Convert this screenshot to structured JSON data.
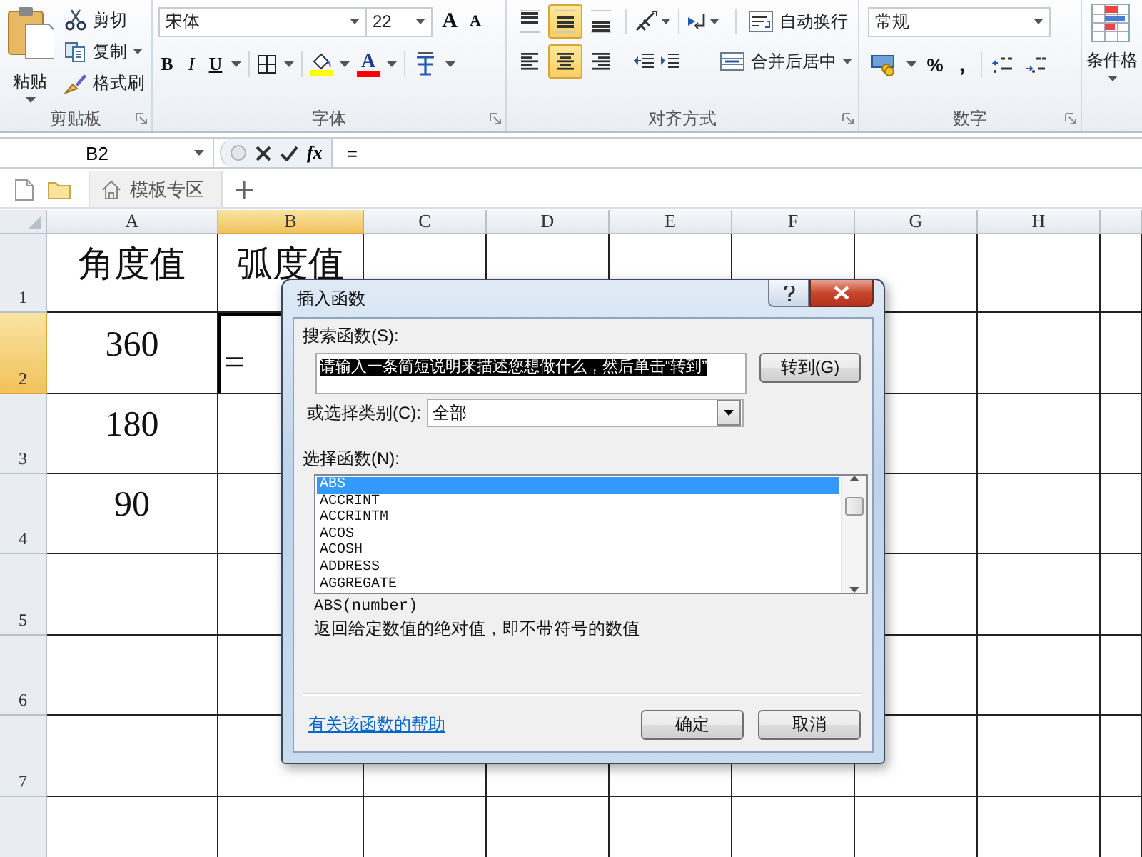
{
  "ribbon": {
    "clipboard": {
      "label": "剪贴板",
      "paste": "粘贴",
      "actions": [
        {
          "kind": "cut",
          "label": "剪切"
        },
        {
          "kind": "copy",
          "label": "复制"
        },
        {
          "kind": "painter",
          "label": "格式刷"
        }
      ]
    },
    "font": {
      "label": "字体",
      "family": "宋体",
      "size": "22",
      "size_tools": [
        {
          "kind": "grow",
          "text": "A"
        },
        {
          "kind": "shrink",
          "text": "A"
        }
      ],
      "styles": [
        {
          "kind": "bold",
          "text": "B"
        },
        {
          "kind": "italic",
          "text": "I"
        },
        {
          "kind": "underline",
          "text": "U"
        }
      ],
      "font_color_text": "A"
    },
    "alignment": {
      "label": "对齐方式",
      "vertical": [
        {
          "kind": "top",
          "selected": false
        },
        {
          "kind": "middle",
          "selected": true
        },
        {
          "kind": "bottom",
          "selected": false
        }
      ],
      "horizontal": [
        {
          "kind": "left",
          "selected": false
        },
        {
          "kind": "center",
          "selected": true
        },
        {
          "kind": "right",
          "selected": false
        }
      ],
      "wrap": "自动换行",
      "merge": "合并后居中"
    },
    "number": {
      "label": "数字",
      "format": "常规",
      "symbols": [
        {
          "kind": "percent",
          "text": "%"
        },
        {
          "kind": "comma",
          "text": ","
        }
      ]
    },
    "styles": {
      "label": "条件格"
    }
  },
  "formula_bar": {
    "name_box": "B2",
    "insert_function": "fx",
    "formula": "="
  },
  "tab_bar": {
    "tabs": [
      {
        "label": "模板专区",
        "selected": false
      }
    ]
  },
  "sheet": {
    "columns": [
      {
        "label": "A",
        "selected": false
      },
      {
        "label": "B",
        "selected": true
      },
      {
        "label": "C",
        "selected": false
      },
      {
        "label": "D",
        "selected": false
      },
      {
        "label": "E",
        "selected": false
      },
      {
        "label": "F",
        "selected": false
      },
      {
        "label": "G",
        "selected": false
      },
      {
        "label": "H",
        "selected": false
      }
    ],
    "rows": [
      {
        "label": "1",
        "selected": false,
        "cells": [
          {
            "text": "角度值",
            "kind": "value",
            "selected": false
          },
          {
            "text": "弧度值",
            "kind": "value",
            "selected": false
          }
        ]
      },
      {
        "label": "2",
        "selected": true,
        "cells": [
          {
            "text": "360",
            "kind": "value",
            "selected": false
          },
          {
            "text": "=",
            "kind": "formula",
            "selected": true
          }
        ]
      },
      {
        "label": "3",
        "selected": false,
        "cells": [
          {
            "text": "180",
            "kind": "value",
            "selected": false
          }
        ]
      },
      {
        "label": "4",
        "selected": false,
        "cells": [
          {
            "text": "90",
            "kind": "value",
            "selected": false
          }
        ]
      },
      {
        "label": "5",
        "selected": false,
        "cells": []
      },
      {
        "label": "6",
        "selected": false,
        "cells": []
      },
      {
        "label": "7",
        "selected": false,
        "cells": []
      }
    ]
  },
  "dialog": {
    "title": "插入函数",
    "search_label": "搜索函数(S):",
    "search_value": "请输入一条简短说明来描述您想做什么，然后单击“转到”",
    "search_text_selected": true,
    "go_button": "转到(G)",
    "category_label": "或选择类别(C):",
    "category": "全部",
    "list_label": "选择函数(N):",
    "functions": [
      {
        "name": "ABS",
        "selected": true
      },
      {
        "name": "ACCRINT",
        "selected": false
      },
      {
        "name": "ACCRINTM",
        "selected": false
      },
      {
        "name": "ACOS",
        "selected": false
      },
      {
        "name": "ACOSH",
        "selected": false
      },
      {
        "name": "ADDRESS",
        "selected": false
      },
      {
        "name": "AGGREGATE",
        "selected": false
      }
    ],
    "signature": "ABS(number)",
    "description": "返回给定数值的绝对值，即不带符号的数值",
    "help_link": "有关该函数的帮助",
    "ok_button": "确定",
    "cancel_button": "取消"
  }
}
